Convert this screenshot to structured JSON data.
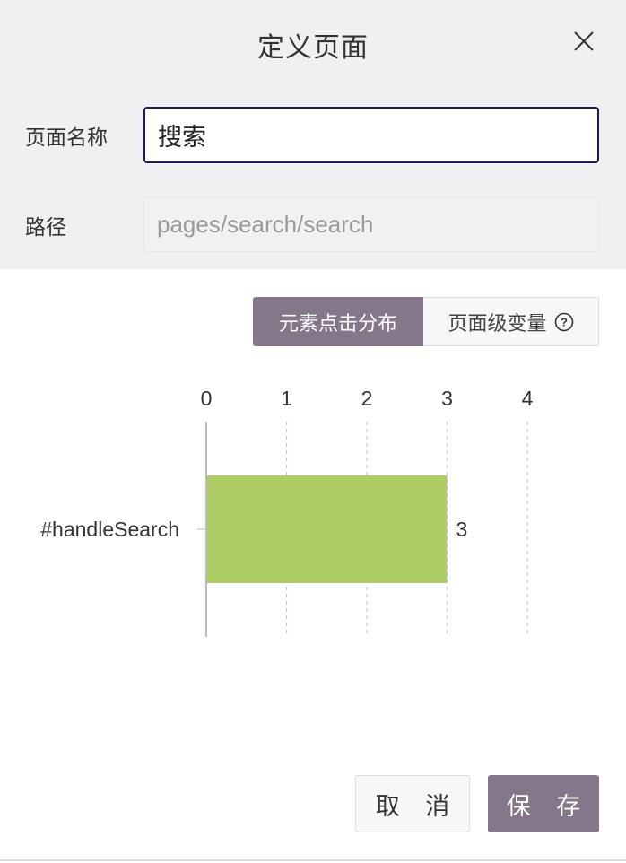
{
  "dialog": {
    "title": "定义页面",
    "close_icon": "close-icon"
  },
  "form": {
    "name_label": "页面名称",
    "name_value": "搜索",
    "path_label": "路径",
    "path_placeholder": "pages/search/search"
  },
  "tabs": [
    {
      "label": "元素点击分布",
      "active": true
    },
    {
      "label": "页面级变量",
      "active": false,
      "icon": "question-circle-icon"
    }
  ],
  "chart_data": {
    "type": "bar",
    "orientation": "horizontal",
    "categories": [
      "#handleSearch"
    ],
    "values": [
      3
    ],
    "x_ticks": [
      "0",
      "1",
      "2",
      "3",
      "4"
    ],
    "xlim": [
      0,
      4
    ],
    "value_labels": [
      "3"
    ],
    "bar_color": "#abcd63",
    "grid": "dashed vertical"
  },
  "buttons": {
    "cancel": "取 消",
    "save": "保 存"
  },
  "colors": {
    "accent": "#85778a",
    "input_focus_border": "#231a58",
    "header_bg": "#eff0f2"
  }
}
